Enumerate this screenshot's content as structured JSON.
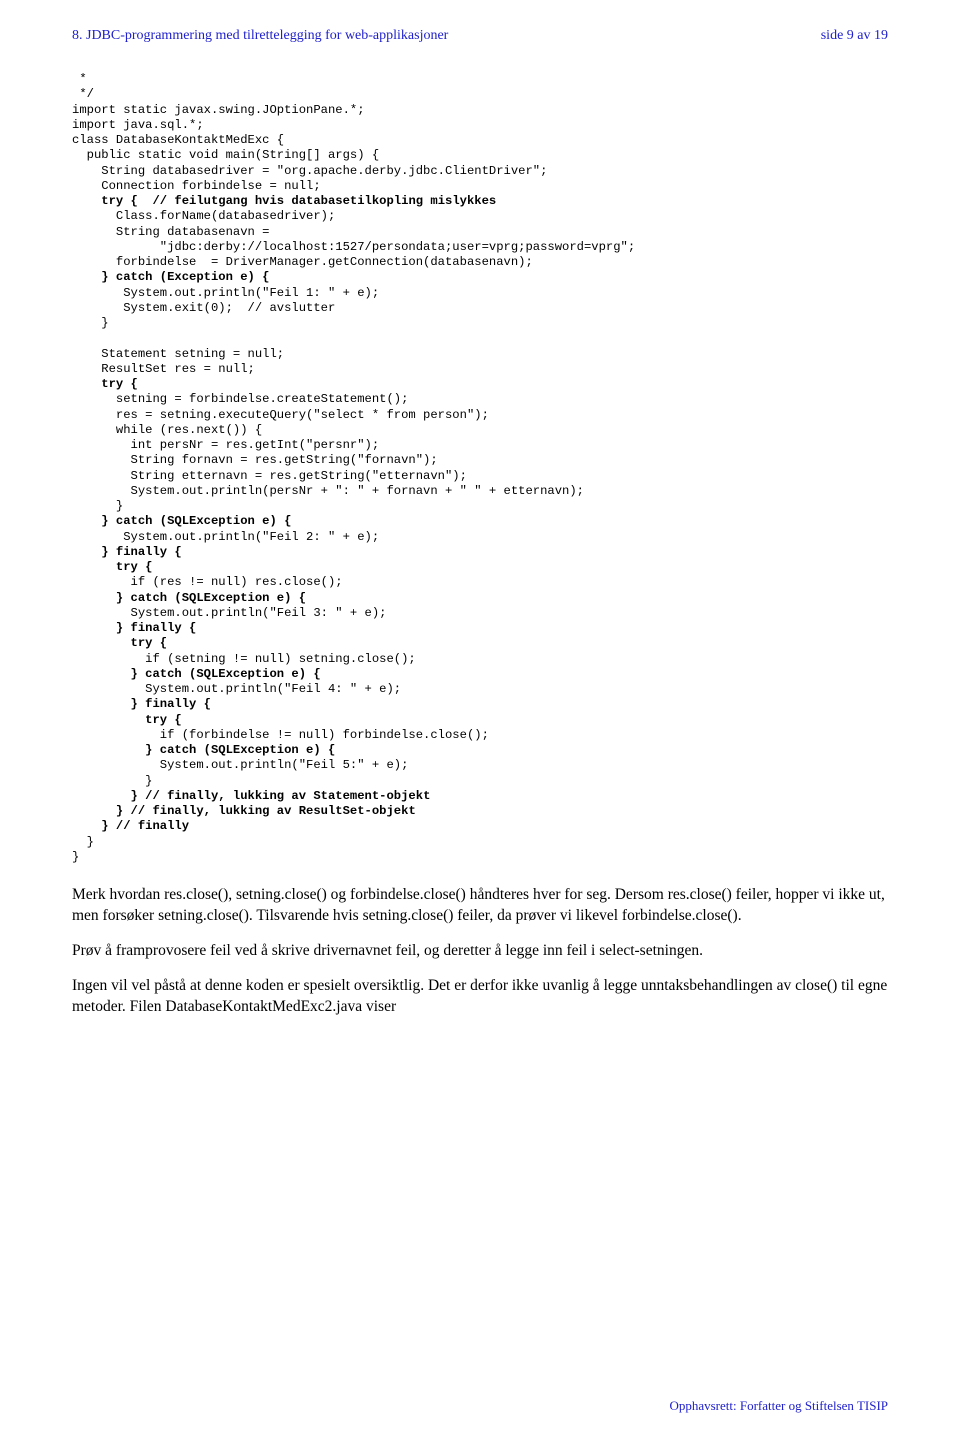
{
  "header": {
    "left": "8. JDBC-programmering med tilrettelegging for web-applikasjoner",
    "right": "side 9 av 19"
  },
  "code": {
    "l1": " *",
    "l2": " */",
    "l3": "import static javax.swing.JOptionPane.*;",
    "l4": "import java.sql.*;",
    "l5": "class DatabaseKontaktMedExc {",
    "l6": "  public static void main(String[] args) {",
    "l7": "    String databasedriver = \"org.apache.derby.jdbc.ClientDriver\";",
    "l8": "    Connection forbindelse = null;",
    "l9a": "    ",
    "l9b": "try {  // feilutgang hvis databasetilkopling mislykkes",
    "l10": "      Class.forName(databasedriver);",
    "l11": "      String databasenavn =",
    "l12": "            \"jdbc:derby://localhost:1527/persondata;user=vprg;password=vprg\";",
    "l13": "      forbindelse  = DriverManager.getConnection(databasenavn);",
    "l14a": "    ",
    "l14b": "} catch (Exception e) {",
    "l15": "       System.out.println(\"Feil 1: \" + e);",
    "l16": "       System.exit(0);  // avslutter",
    "l17": "    }",
    "l18": "",
    "l19": "    Statement setning = null;",
    "l20": "    ResultSet res = null;",
    "l21a": "    ",
    "l21b": "try {",
    "l22": "      setning = forbindelse.createStatement();",
    "l23": "      res = setning.executeQuery(\"select * from person\");",
    "l24": "      while (res.next()) {",
    "l25": "        int persNr = res.getInt(\"persnr\");",
    "l26": "        String fornavn = res.getString(\"fornavn\");",
    "l27": "        String etternavn = res.getString(\"etternavn\");",
    "l28": "        System.out.println(persNr + \": \" + fornavn + \" \" + etternavn);",
    "l29": "      }",
    "l30a": "    ",
    "l30b": "} catch (SQLException e) {",
    "l31": "       System.out.println(\"Feil 2: \" + e);",
    "l32a": "    ",
    "l32b": "} finally {",
    "l33a": "      ",
    "l33b": "try {",
    "l34": "        if (res != null) res.close();",
    "l35a": "      ",
    "l35b": "} catch (SQLException e) {",
    "l36": "        System.out.println(\"Feil 3: \" + e);",
    "l37a": "      ",
    "l37b": "} finally {",
    "l38a": "        ",
    "l38b": "try {",
    "l39": "          if (setning != null) setning.close();",
    "l40a": "        ",
    "l40b": "} catch (SQLException e) {",
    "l41": "          System.out.println(\"Feil 4: \" + e);",
    "l42a": "        ",
    "l42b": "} finally {",
    "l43a": "          ",
    "l43b": "try {",
    "l44": "            if (forbindelse != null) forbindelse.close();",
    "l45a": "          ",
    "l45b": "} catch (SQLException e) {",
    "l46": "            System.out.println(\"Feil 5:\" + e);",
    "l47": "          }",
    "l48a": "        ",
    "l48b": "} // finally, lukking av Statement-objekt",
    "l49a": "      ",
    "l49b": "} // finally, lukking av ResultSet-objekt",
    "l50a": "    ",
    "l50b": "} // finally",
    "l51": "  }",
    "l52": "}"
  },
  "para1": "Merk hvordan res.close(), setning.close() og forbindelse.close() håndteres hver for seg. Dersom res.close() feiler, hopper vi ikke ut, men forsøker setning.close(). Tilsvarende hvis setning.close() feiler, da prøver vi likevel forbindelse.close().",
  "para2": "Prøv å framprovosere feil ved å skrive drivernavnet feil, og deretter å legge inn feil i select-setningen.",
  "para3": "Ingen vil vel påstå at denne koden er spesielt oversiktlig. Det er derfor ikke uvanlig å legge unntaksbehandlingen av close() til egne metoder. Filen DatabaseKontaktMedExc2.java viser",
  "footer": "Opphavsrett:  Forfatter og Stiftelsen TISIP"
}
